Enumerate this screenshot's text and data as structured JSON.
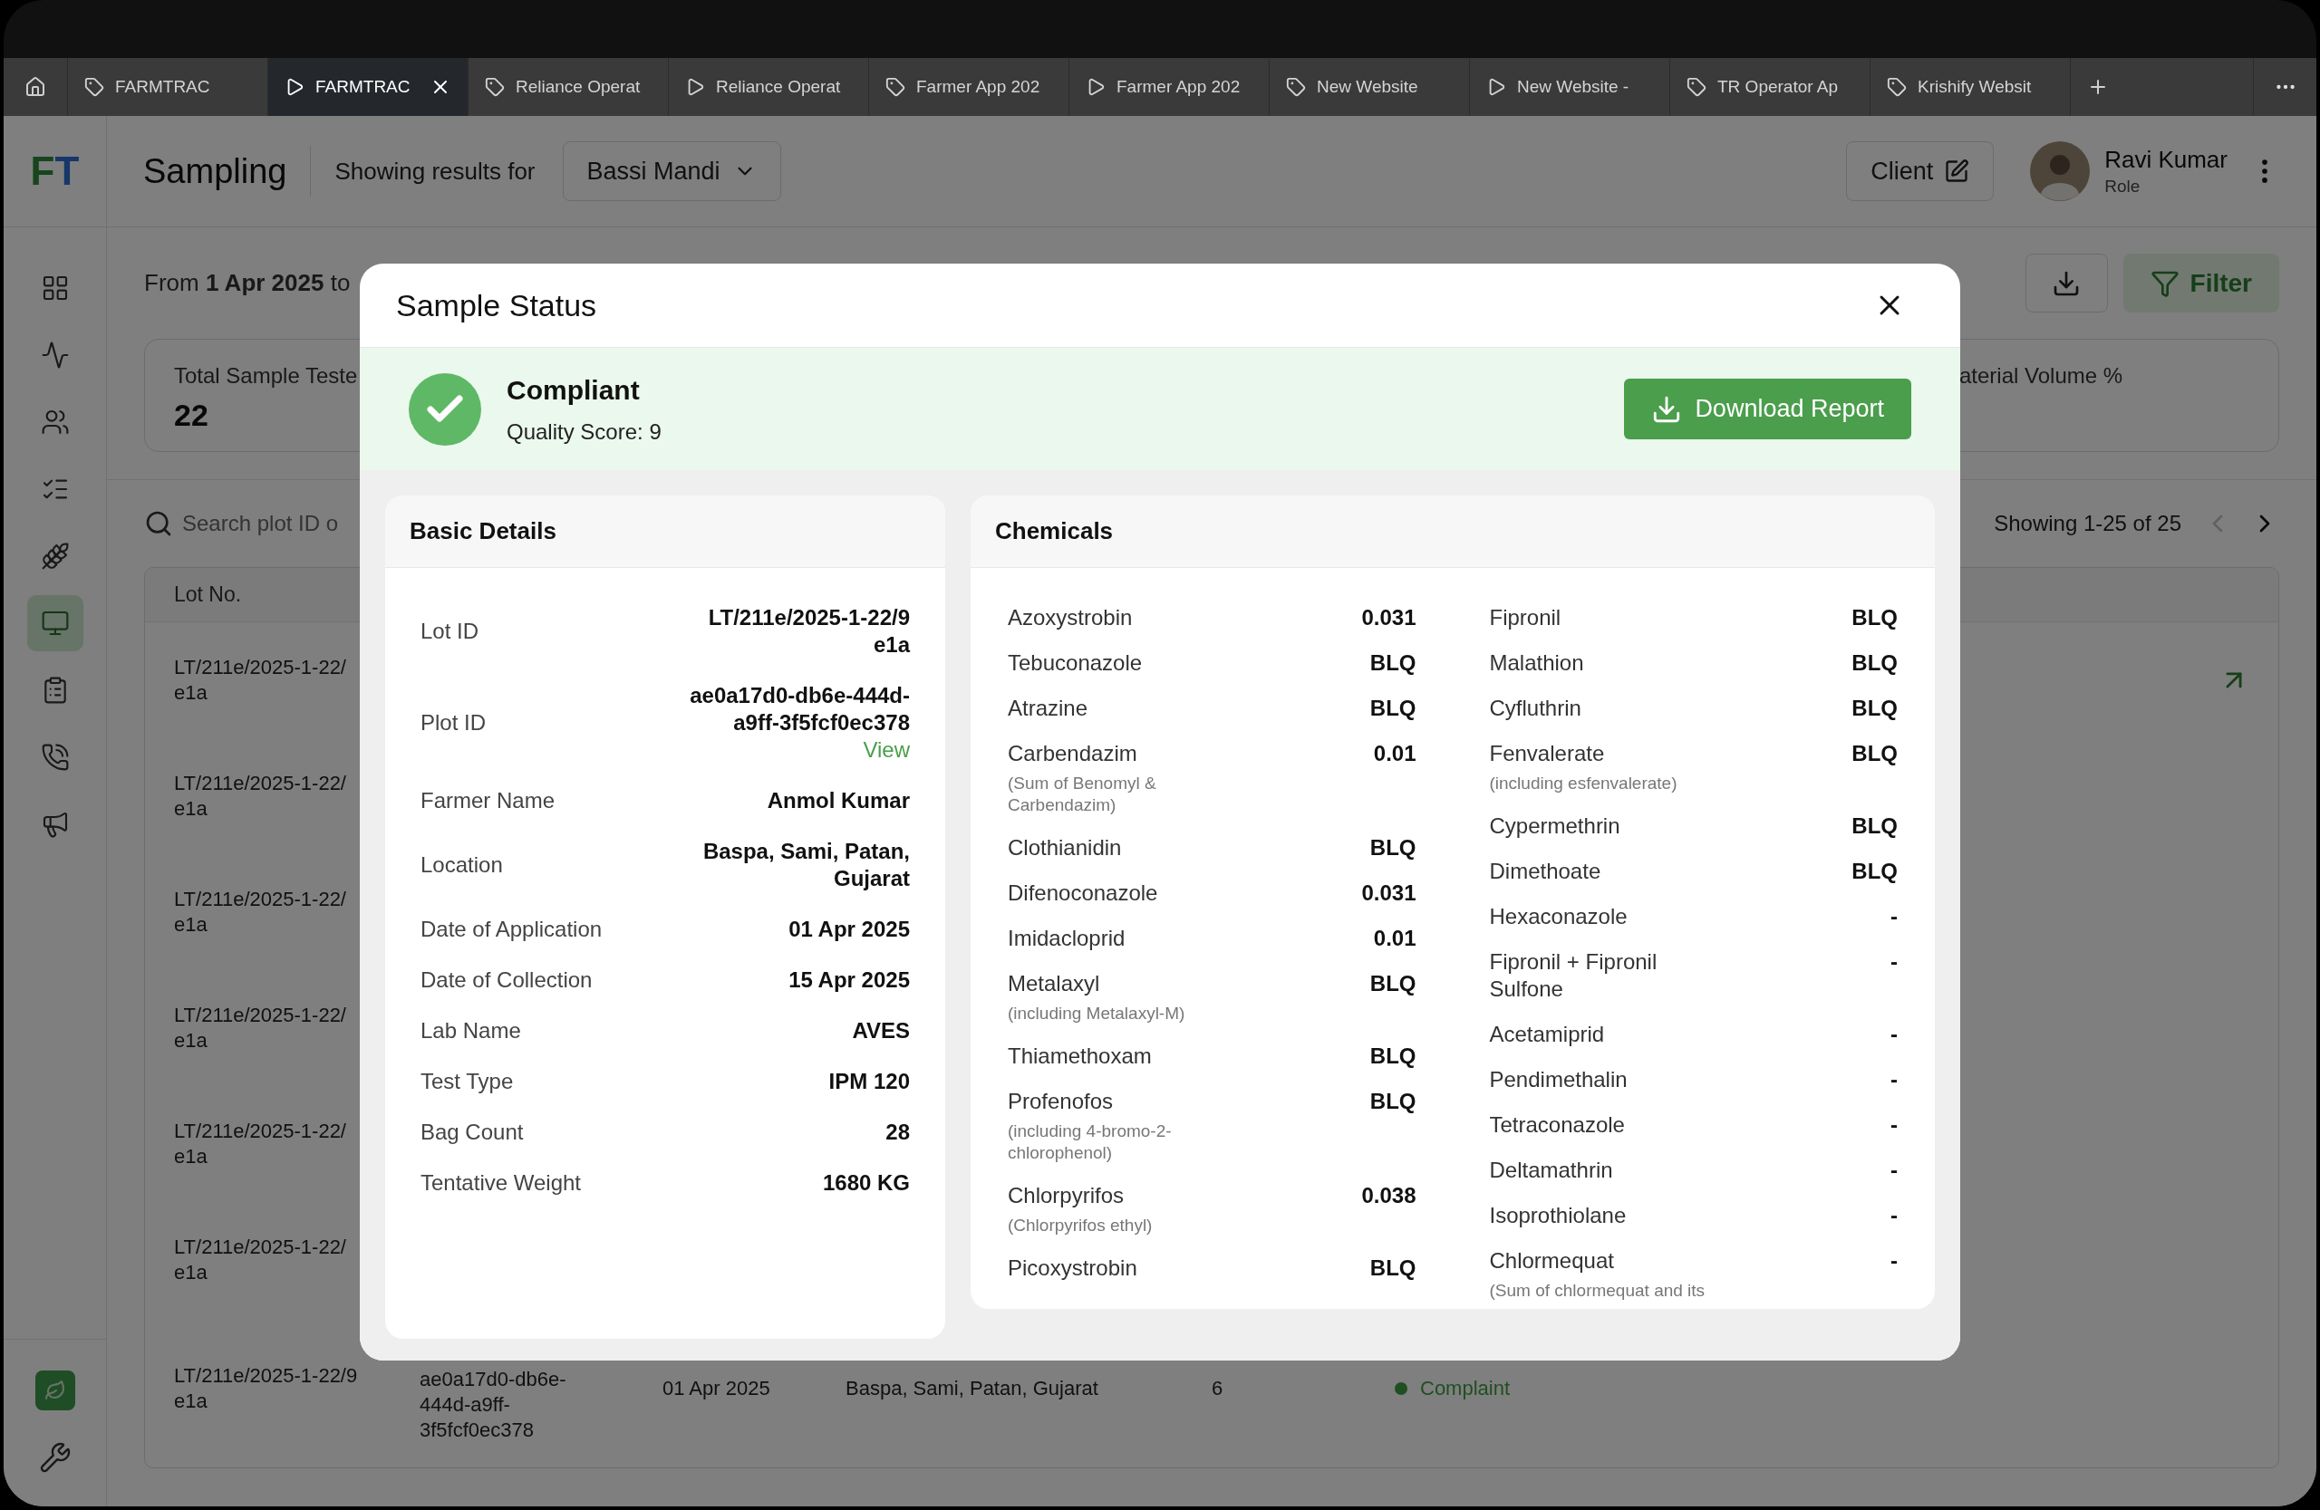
{
  "browser_tabs": [
    {
      "label": "FARMTRAC",
      "kind": "tag",
      "selected": false
    },
    {
      "label": "FARMTRAC",
      "kind": "play",
      "selected": true
    },
    {
      "label": "Reliance Operat",
      "kind": "tag",
      "selected": false
    },
    {
      "label": "Reliance Operat",
      "kind": "play",
      "selected": false
    },
    {
      "label": "Farmer App 202",
      "kind": "tag",
      "selected": false
    },
    {
      "label": "Farmer App 202",
      "kind": "play",
      "selected": false
    },
    {
      "label": "New Website",
      "kind": "tag",
      "selected": false
    },
    {
      "label": "New Website -",
      "kind": "play",
      "selected": false
    },
    {
      "label": "TR Operator Ap",
      "kind": "tag",
      "selected": false
    },
    {
      "label": "Krishify Websit",
      "kind": "tag",
      "selected": false
    }
  ],
  "sidebar": {
    "logo": "FT",
    "items": [
      {
        "selected": false
      },
      {
        "selected": false
      },
      {
        "selected": false
      },
      {
        "selected": false
      },
      {
        "selected": false
      },
      {
        "selected": true
      },
      {
        "selected": false
      },
      {
        "selected": false
      },
      {
        "selected": false
      }
    ]
  },
  "header": {
    "title": "Sampling",
    "filter_label": "Showing results for",
    "location": "Bassi Mandi",
    "client_button": "Client",
    "user": {
      "name": "Ravi Kumar",
      "role": "Role"
    }
  },
  "date_range": "From **1 Apr 2025** to",
  "filter_button": "Filter",
  "stats": {
    "total_label": "Total Sample Teste",
    "total_value": "22",
    "column_2_label": "aterial Volume %"
  },
  "search": {
    "placeholder": "Search plot ID o"
  },
  "pagination": {
    "text": "Showing 1-25 of 25",
    "prev_disabled": true
  },
  "table": {
    "columns": [
      "Lot No."
    ],
    "rows": [
      {
        "lot": [
          "LT/211e/2025-1-22/",
          "e1a"
        ]
      },
      {
        "lot": [
          "LT/211e/2025-1-22/",
          "e1a"
        ]
      },
      {
        "lot": [
          "LT/211e/2025-1-22/",
          "e1a"
        ]
      },
      {
        "lot": [
          "LT/211e/2025-1-22/",
          "e1a"
        ]
      },
      {
        "lot": [
          "LT/211e/2025-1-22/",
          "e1a"
        ]
      },
      {
        "lot": [
          "LT/211e/2025-1-22/",
          "e1a"
        ]
      }
    ],
    "last_row": {
      "lot": [
        "LT/211e/2025-1-22/9",
        "e1a"
      ],
      "plot_id": "ae0a17d0-db6e-444d-a9ff-3f5fcf0ec378",
      "date": "01 Apr 2025",
      "location": "Baspa, Sami, Patan, Gujarat",
      "count": "6",
      "status": {
        "text": "Complaint",
        "color": "#1f4f21"
      }
    }
  },
  "modal": {
    "title": "Sample Status",
    "status": {
      "label": "Compliant",
      "compliant": true,
      "score": "Quality Score: 9"
    },
    "download_button": "Download Report",
    "basic_details": {
      "title": "Basic Details",
      "rows": [
        {
          "label": "Lot ID",
          "value": [
            "LT/211e/2025-1-22/9",
            "e1a"
          ]
        },
        {
          "label": "Plot ID",
          "value": "ae0a17d0-db6e-444d-a9ff-3f5fcf0ec378",
          "link": "View"
        },
        {
          "label": "Farmer Name",
          "value": "Anmol Kumar"
        },
        {
          "label": "Location",
          "value": "Baspa, Sami, Patan, Gujarat"
        },
        {
          "label": "Date of Application",
          "value": "01 Apr 2025"
        },
        {
          "label": "Date of Collection",
          "value": "15 Apr 2025"
        },
        {
          "label": "Lab Name",
          "value": "AVES"
        },
        {
          "label": "Test Type",
          "value": "IPM 120"
        },
        {
          "label": "Bag Count",
          "value": "28"
        },
        {
          "label": "Tentative Weight",
          "value": "1680 KG"
        }
      ]
    },
    "chemicals": {
      "title": "Chemicals",
      "columns": [
        [
          {
            "name": "Azoxystrobin",
            "value": "0.031"
          },
          {
            "name": "Tebuconazole",
            "value": "BLQ"
          },
          {
            "name": "Atrazine",
            "value": "BLQ"
          },
          {
            "name": "Carbendazim",
            "note": "(Sum of Benomyl & Carbendazim)",
            "value": "0.01"
          },
          {
            "name": "Clothianidin",
            "value": "BLQ"
          },
          {
            "name": "Difenoconazole",
            "value": "0.031"
          },
          {
            "name": "Imidacloprid",
            "value": "0.01"
          },
          {
            "name": "Metalaxyl",
            "note": "(including Metalaxyl-M)",
            "value": "BLQ"
          },
          {
            "name": "Thiamethoxam",
            "value": "BLQ"
          },
          {
            "name": "Profenofos",
            "note": "(including 4-bromo-2-chlorophenol)",
            "value": "BLQ"
          },
          {
            "name": "Chlorpyrifos",
            "note": "(Chlorpyrifos ethyl)",
            "value": "0.038"
          },
          {
            "name": "Picoxystrobin",
            "value": "BLQ"
          }
        ],
        [
          {
            "name": "Fipronil",
            "value": "BLQ"
          },
          {
            "name": "Malathion",
            "value": "BLQ"
          },
          {
            "name": "Cyfluthrin",
            "value": "BLQ"
          },
          {
            "name": "Fenvalerate",
            "note": "(including esfenvalerate)",
            "value": "BLQ"
          },
          {
            "name": "Cypermethrin",
            "value": "BLQ"
          },
          {
            "name": "Dimethoate",
            "value": "BLQ"
          },
          {
            "name": "Hexaconazole",
            "value": "-"
          },
          {
            "name": "Fipronil + Fipronil Sulfone",
            "value": "-"
          },
          {
            "name": "Acetamiprid",
            "value": "-"
          },
          {
            "name": "Pendimethalin",
            "value": "-"
          },
          {
            "name": "Tetraconazole",
            "value": "-"
          },
          {
            "name": "Deltamathrin",
            "value": "-"
          },
          {
            "name": "Isoprothiolane",
            "value": "-"
          },
          {
            "name": "Chlormequat",
            "note": "(Sum of chlormequat and its",
            "value": "-"
          }
        ]
      ]
    }
  }
}
